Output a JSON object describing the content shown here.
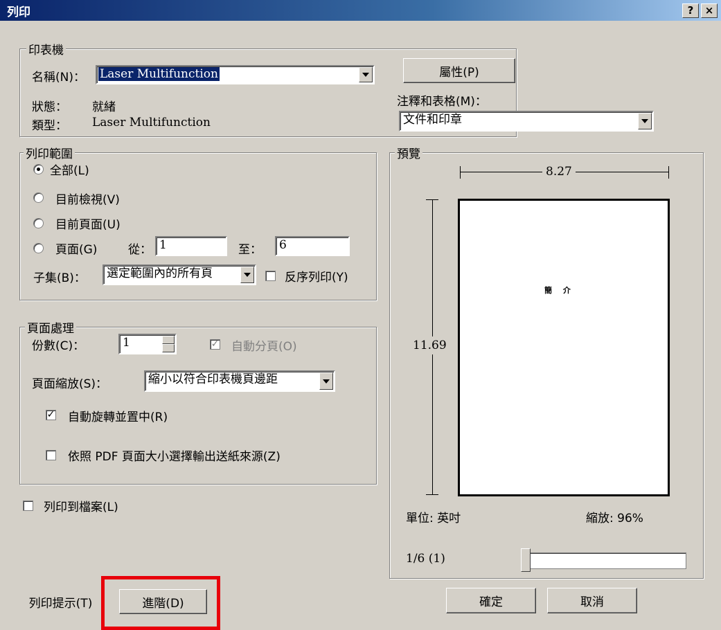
{
  "window": {
    "title": "列印",
    "help_glyph": "?",
    "close_glyph": "×"
  },
  "printer": {
    "legend": "印表機",
    "name_label": "名稱(N)：",
    "name_value": "Laser Multifunction",
    "status_label": "狀態：",
    "status_value": "就緒",
    "type_label": "類型：",
    "type_value": "Laser Multifunction",
    "properties_button": "屬性(P)",
    "comments_label": "注釋和表格(M)：",
    "comments_value": "文件和印章"
  },
  "range": {
    "legend": "列印範圍",
    "all": "全部(L)",
    "current_view": "目前檢視(V)",
    "current_page": "目前頁面(U)",
    "pages": "頁面(G)",
    "from_label": "從：",
    "from_value": "1",
    "to_label": "至：",
    "to_value": "6",
    "subset_label": "子集(B)：",
    "subset_value": "選定範圍內的所有頁",
    "reverse_label": "反序列印(Y)"
  },
  "handling": {
    "legend": "頁面處理",
    "copies_label": "份數(C)：",
    "copies_value": "1",
    "collate_label": "自動分頁(O)",
    "scaling_label": "頁面縮放(S)：",
    "scaling_value": "縮小以符合印表機頁邊距",
    "autorotate_label": "自動旋轉並置中(R)",
    "paper_source_label": "依照 PDF 頁面大小選擇輸出送紙來源(Z)",
    "check_mark": "✓"
  },
  "print_to_file": "列印到檔案(L)",
  "preview": {
    "legend": "預覽",
    "width": "8.27",
    "height": "11.69",
    "page_text": "簡 介",
    "units": "單位: 英吋",
    "zoom": "縮放: 96%",
    "page_counter": "1/6 (1)"
  },
  "footer": {
    "tips_button": "列印提示(T)",
    "advanced_button": "進階(D)",
    "ok_button": "確定",
    "cancel_button": "取消"
  },
  "colors": {
    "highlight": "#e8000b",
    "title_bar": "#0a246a"
  }
}
